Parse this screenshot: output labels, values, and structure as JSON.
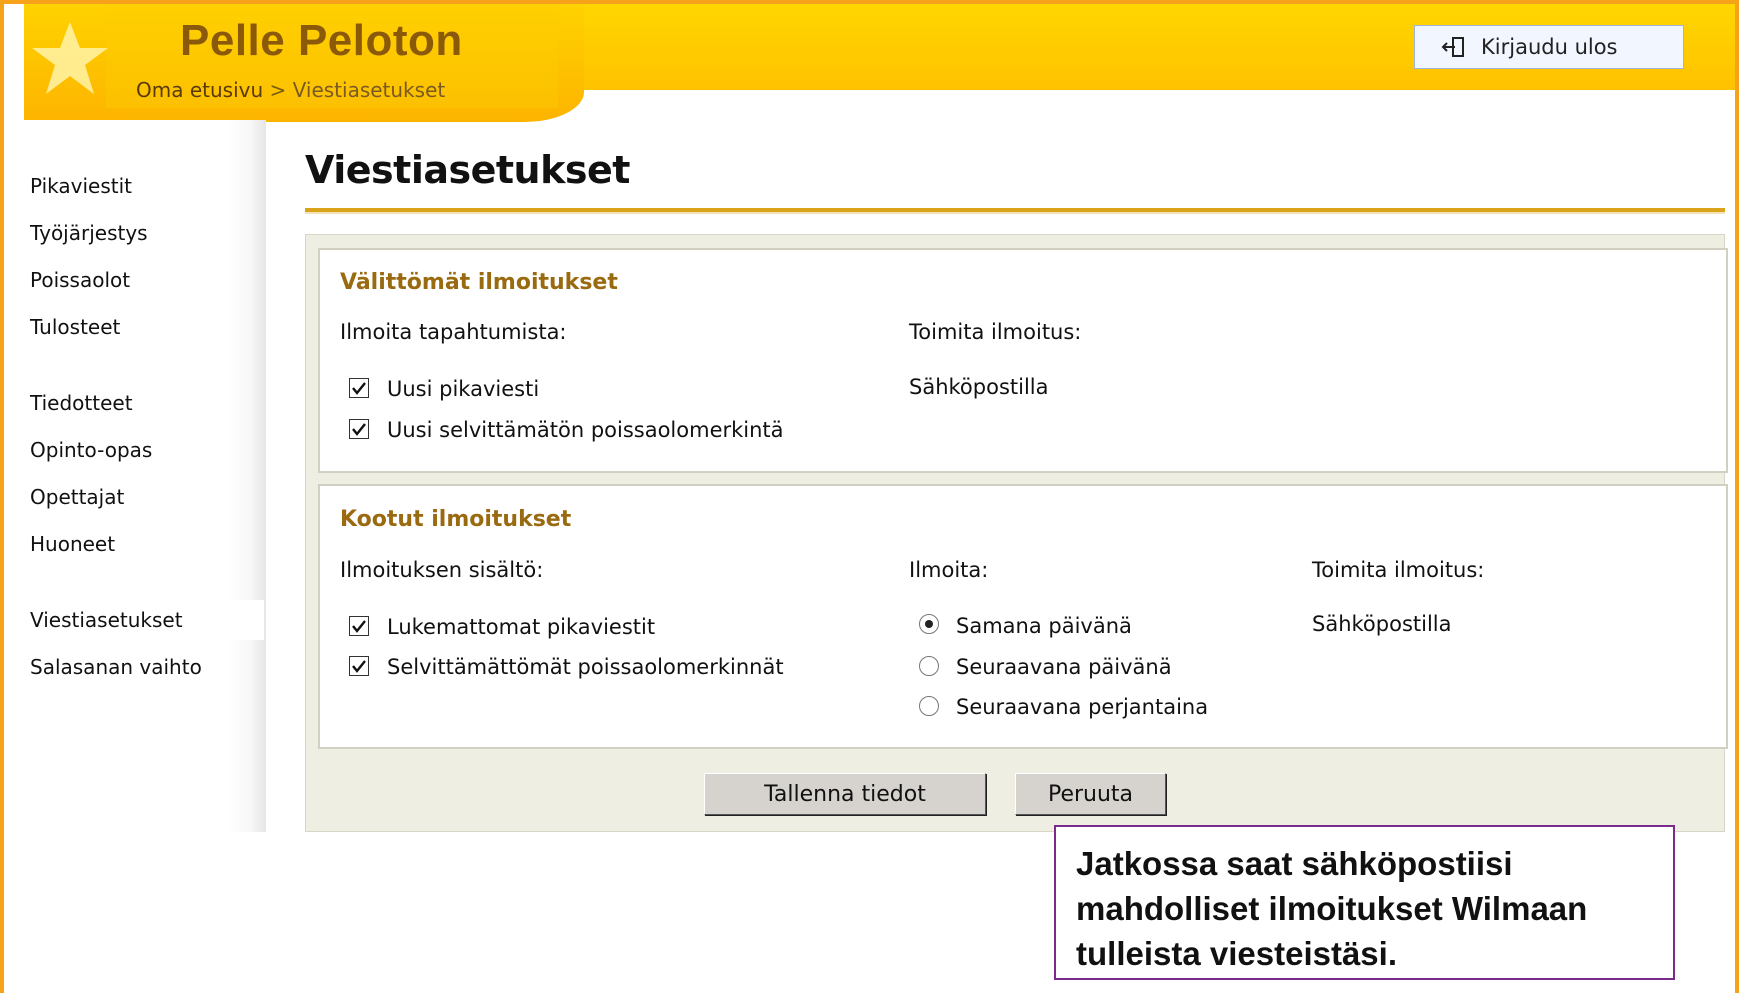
{
  "header": {
    "site_title": "Pelle Peloton",
    "breadcrumb_home": "Oma etusivu",
    "breadcrumb_separator": ">",
    "breadcrumb_current": "Viestiasetukset",
    "logout_label": "Kirjaudu ulos",
    "logout_icon": "logout-icon"
  },
  "sidebar": {
    "items": [
      {
        "label": "Pikaviestit"
      },
      {
        "label": "Työjärjestys"
      },
      {
        "label": "Poissaolot"
      },
      {
        "label": "Tulosteet"
      },
      {
        "label": "Tiedotteet"
      },
      {
        "label": "Opinto-opas"
      },
      {
        "label": "Opettajat"
      },
      {
        "label": "Huoneet"
      },
      {
        "label": "Viestiasetukset"
      },
      {
        "label": "Salasanan vaihto"
      }
    ]
  },
  "main": {
    "page_title": "Viestiasetukset",
    "immediate": {
      "title": "Välittömät ilmoitukset",
      "events_label": "Ilmoita tapahtumista:",
      "deliver_label": "Toimita ilmoitus:",
      "options": [
        {
          "label": "Uusi pikaviesti",
          "checked": true
        },
        {
          "label": "Uusi selvittämätön poissaolomerkintä",
          "checked": true
        }
      ],
      "delivery_method": "Sähköpostilla"
    },
    "summary": {
      "title": "Kootut ilmoitukset",
      "content_label": "Ilmoituksen sisältö:",
      "notify_label": "Ilmoita:",
      "deliver_label": "Toimita ilmoitus:",
      "options": [
        {
          "label": "Lukemattomat pikaviestit",
          "checked": true
        },
        {
          "label": "Selvittämättömät poissaolomerkinnät",
          "checked": true
        }
      ],
      "timing": [
        {
          "label": "Samana päivänä",
          "selected": true
        },
        {
          "label": "Seuraavana päivänä",
          "selected": false
        },
        {
          "label": "Seuraavana perjantaina",
          "selected": false
        }
      ],
      "delivery_method": "Sähköpostilla"
    },
    "save_label": "Tallenna tiedot",
    "cancel_label": "Peruuta"
  },
  "callout": {
    "lines": [
      "Jatkossa saat sähköpostiisi",
      "mahdolliset ilmoitukset Wilmaan",
      "tulleista viesteistäsi."
    ]
  },
  "colors": {
    "frame": "#f7a21b",
    "header": "#ffc800",
    "section_title": "#9a6a10",
    "callout_border": "#7a2a8a"
  }
}
